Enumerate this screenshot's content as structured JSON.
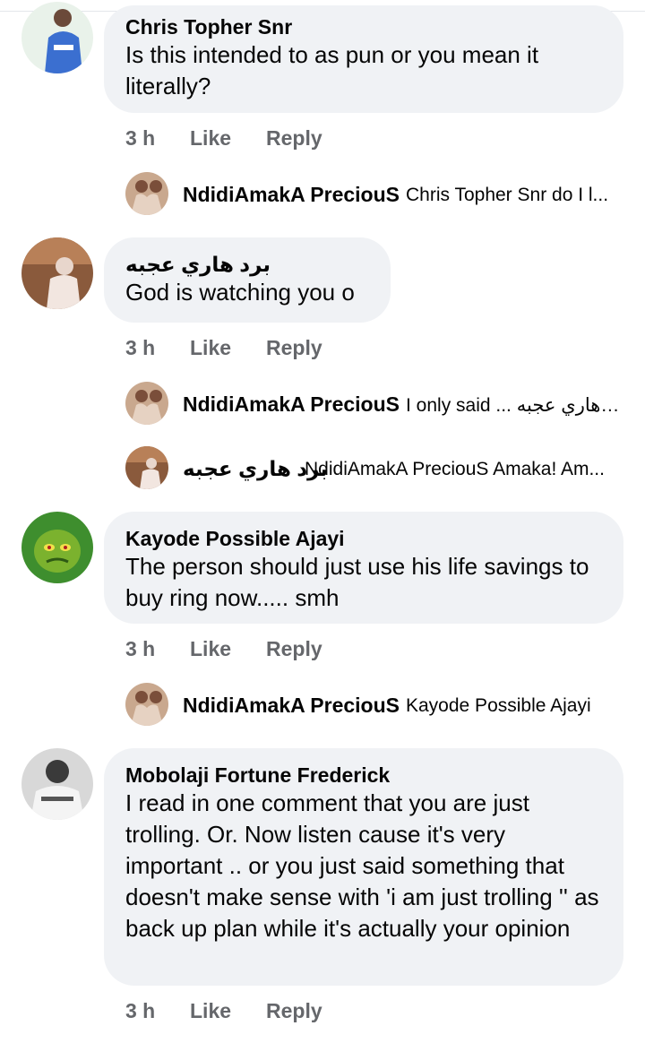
{
  "comments": [
    {
      "author": "Chris Topher Snr",
      "text": "Is this intended to as pun or you mean it literally?",
      "time": "3 h",
      "like": "Like",
      "reply": "Reply",
      "replies": [
        {
          "author": "NdidiAmakA PreciouS",
          "preview": "Chris Topher Snr do I l..."
        }
      ]
    },
    {
      "author": "برد هاري عجبه",
      "text": "God is watching you o",
      "time": "3 h",
      "like": "Like",
      "reply": "Reply",
      "replies": [
        {
          "author": "NdidiAmakA PreciouS",
          "preview": "I only said ... برد هاري عجبه"
        },
        {
          "author": "برد هاري عجبه",
          "preview": "NdidiAmakA PreciouS Amaka! Am..."
        }
      ]
    },
    {
      "author": "Kayode Possible Ajayi",
      "text": "The person should just use his life savings to buy ring now..... smh",
      "time": "3 h",
      "like": "Like",
      "reply": "Reply",
      "replies": [
        {
          "author": "NdidiAmakA PreciouS",
          "preview": "Kayode Possible Ajayi"
        }
      ]
    },
    {
      "author": "Mobolaji Fortune Frederick",
      "text": "I read in one comment that you are just trolling.  Or.  Now listen cause it's very important ..  or you just said something that doesn't make sense with 'i am just trolling '' as back up plan while it's actually your opinion",
      "time": "3 h",
      "like": "Like",
      "reply": "Reply",
      "replies": []
    }
  ],
  "colors": {
    "bubble": "#f0f2f5",
    "meta": "#65676b",
    "text": "#050505"
  }
}
